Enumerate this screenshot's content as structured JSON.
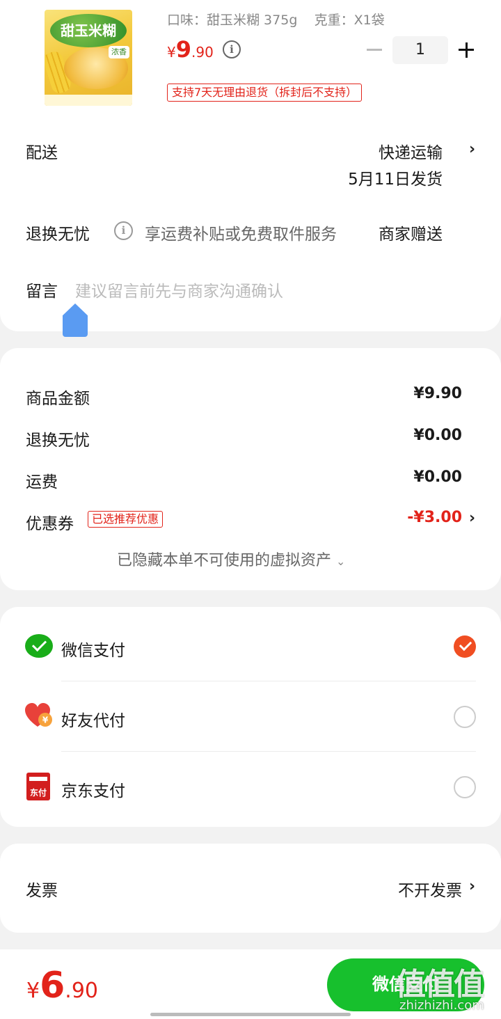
{
  "product": {
    "image_title": "甜玉米糊",
    "spec_flavor_label": "口味：",
    "spec_flavor_value": "甜玉米糊 375g",
    "spec_weight_label": "克重：",
    "spec_weight_value": "X1袋",
    "price_symbol": "¥",
    "price_int": "9",
    "price_dec": ".90",
    "quantity": "1",
    "return_policy": "支持7天无理由退货（拆封后不支持）"
  },
  "delivery": {
    "label": "配送",
    "method": "快递运输",
    "ship_date": "5月11日发货"
  },
  "returns": {
    "label": "退换无忧",
    "description": "享运费补贴或免费取件服务",
    "provider": "商家赠送"
  },
  "message": {
    "label": "留言",
    "placeholder": "建议留言前先与商家沟通确认"
  },
  "summary": {
    "goods_label": "商品金额",
    "goods_value": "¥9.90",
    "returns_label": "退换无忧",
    "returns_value": "¥0.00",
    "shipping_label": "运费",
    "shipping_value": "¥0.00",
    "coupon_label": "优惠券",
    "coupon_tag": "已选推荐优惠",
    "coupon_value": "-¥3.00",
    "hidden_assets": "已隐藏本单不可使用的虚拟资产"
  },
  "payment": {
    "options": [
      {
        "label": "微信支付",
        "selected": true
      },
      {
        "label": "好友代付",
        "selected": false
      },
      {
        "label": "京东支付",
        "selected": false
      }
    ],
    "jd_icon_text": "东付",
    "friend_icon_text": "¥"
  },
  "invoice": {
    "label": "发票",
    "value": "不开发票"
  },
  "footer": {
    "total_symbol": "¥",
    "total_int": "6",
    "total_dec": ".90",
    "pay_button": "微信支付",
    "watermark": "值值值",
    "watermark_sub": "zhizhizhi.com"
  },
  "colors": {
    "accent_red": "#e2231a",
    "pay_green": "#17c02d",
    "check_orange": "#f04e22"
  }
}
